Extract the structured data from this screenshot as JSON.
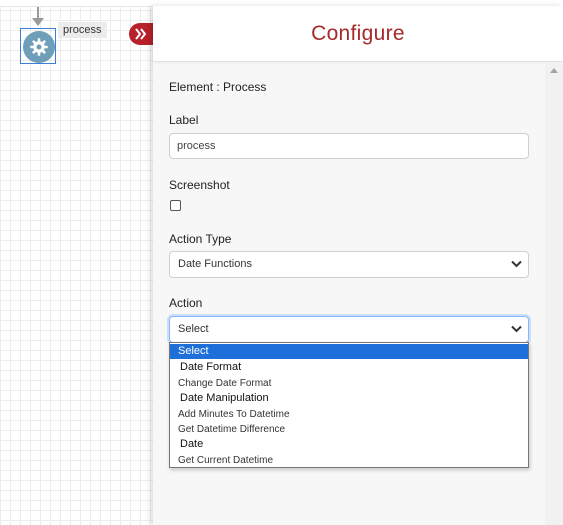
{
  "canvas": {
    "node_label": "process"
  },
  "panel": {
    "title": "Configure",
    "element_line": "Element : Process",
    "label_field": {
      "label": "Label",
      "value": "process"
    },
    "screenshot_field": {
      "label": "Screenshot",
      "checked": false
    },
    "action_type_field": {
      "label": "Action Type",
      "selected": "Date Functions"
    },
    "action_field": {
      "label": "Action",
      "selected": "Select",
      "options": [
        {
          "text": "Select",
          "kind": "option",
          "selected": true
        },
        {
          "text": "Date Format",
          "kind": "group"
        },
        {
          "text": "Change Date Format",
          "kind": "option"
        },
        {
          "text": "Date Manipulation",
          "kind": "group"
        },
        {
          "text": "Add Minutes To Datetime",
          "kind": "option"
        },
        {
          "text": "Get Datetime Difference",
          "kind": "option"
        },
        {
          "text": "Date",
          "kind": "group"
        },
        {
          "text": "Get Current Datetime",
          "kind": "option"
        }
      ]
    }
  },
  "colors": {
    "accent": "#a52a2a",
    "collapse_button": "#b8202a",
    "node": "#6f9eb8",
    "selection": "#1e6fd9"
  },
  "icons": {
    "node": "gear-icon",
    "collapse": "double-chevron-right-icon",
    "select_arrow": "chevron-down-icon"
  }
}
